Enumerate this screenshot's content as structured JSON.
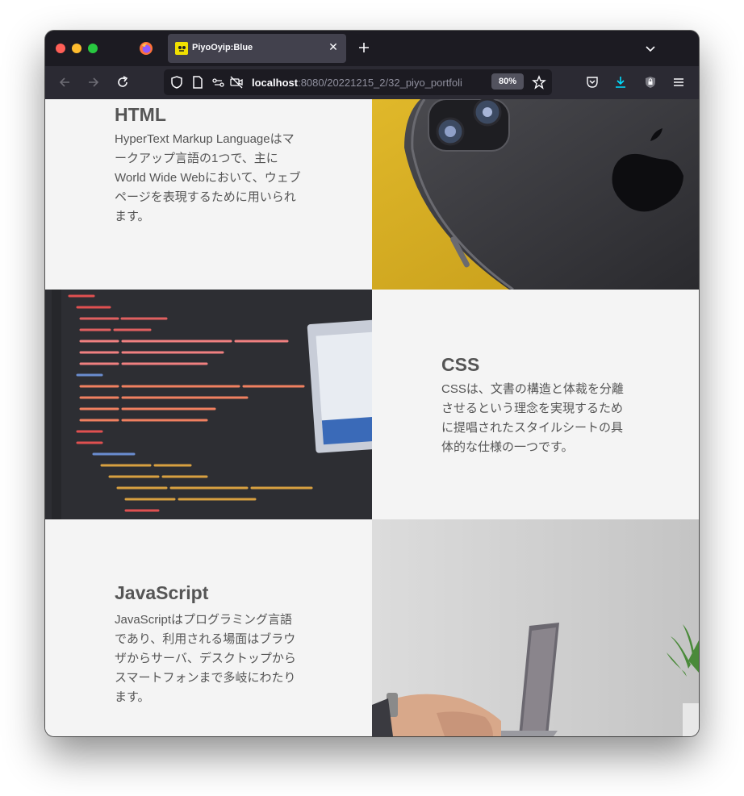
{
  "browser": {
    "tab_title": "PiyoOyip:Blue",
    "url_host": "localhost",
    "url_path": ":8080/20221215_2/32_piyo_portfoli",
    "zoom": "80%"
  },
  "sections": [
    {
      "title": "HTML",
      "description": "HyperText Markup Languageはマークアップ言語の1つで、主にWorld Wide Webにおいて、ウェブページを表現するために用いられます。"
    },
    {
      "title": "CSS",
      "description": "CSSは、文書の構造と体裁を分離させるという理念を実現するために提唱されたスタイルシートの具体的な仕様の一つです。"
    },
    {
      "title": "JavaScript",
      "description": "JavaScriptはプログラミング言語であり、利用される場面はブラウザからサーバ、デスクトップからスマートフォンまで多岐にわたります。"
    }
  ],
  "colors": {
    "section_bg": "#f4f4f4",
    "text": "#555555",
    "browser_chrome": "#1c1b22",
    "accent_download": "#00ddff"
  }
}
